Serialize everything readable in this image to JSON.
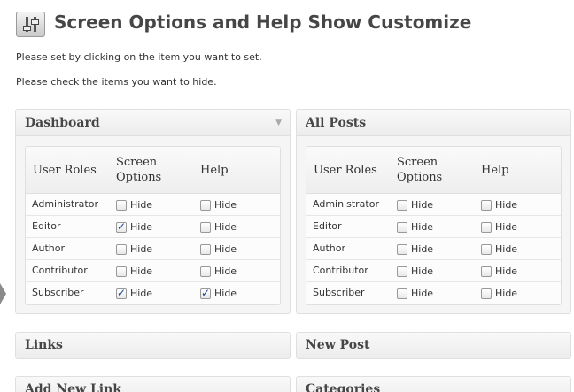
{
  "header": {
    "title": "Screen Options and Help Show Customize",
    "icon": "settings-sliders-icon"
  },
  "intro": {
    "line1": "Please set by clicking on the item you want to set.",
    "line2": "Please check the items you want to hide."
  },
  "boxes": {
    "dashboard": {
      "title": "Dashboard",
      "toggle": "▼",
      "columns": [
        "User Roles",
        "Screen Options",
        "Help"
      ],
      "rows": [
        {
          "role": "Administrator",
          "screen_label": "Hide",
          "screen_checked": false,
          "help_label": "Hide",
          "help_checked": false
        },
        {
          "role": "Editor",
          "screen_label": "Hide",
          "screen_checked": true,
          "help_label": "Hide",
          "help_checked": false
        },
        {
          "role": "Author",
          "screen_label": "Hide",
          "screen_checked": false,
          "help_label": "Hide",
          "help_checked": false
        },
        {
          "role": "Contributor",
          "screen_label": "Hide",
          "screen_checked": false,
          "help_label": "Hide",
          "help_checked": false
        },
        {
          "role": "Subscriber",
          "screen_label": "Hide",
          "screen_checked": true,
          "help_label": "Hide",
          "help_checked": true
        }
      ]
    },
    "all_posts": {
      "title": "All Posts",
      "columns": [
        "User Roles",
        "Screen Options",
        "Help"
      ],
      "rows": [
        {
          "role": "Administrator",
          "screen_label": "Hide",
          "screen_checked": false,
          "help_label": "Hide",
          "help_checked": false
        },
        {
          "role": "Editor",
          "screen_label": "Hide",
          "screen_checked": false,
          "help_label": "Hide",
          "help_checked": false
        },
        {
          "role": "Author",
          "screen_label": "Hide",
          "screen_checked": false,
          "help_label": "Hide",
          "help_checked": false
        },
        {
          "role": "Contributor",
          "screen_label": "Hide",
          "screen_checked": false,
          "help_label": "Hide",
          "help_checked": false
        },
        {
          "role": "Subscriber",
          "screen_label": "Hide",
          "screen_checked": false,
          "help_label": "Hide",
          "help_checked": false
        }
      ]
    },
    "links": {
      "title": "Links"
    },
    "new_post": {
      "title": "New Post"
    },
    "add_new_link": {
      "title": "Add New Link"
    },
    "categories": {
      "title": "Categories"
    }
  }
}
